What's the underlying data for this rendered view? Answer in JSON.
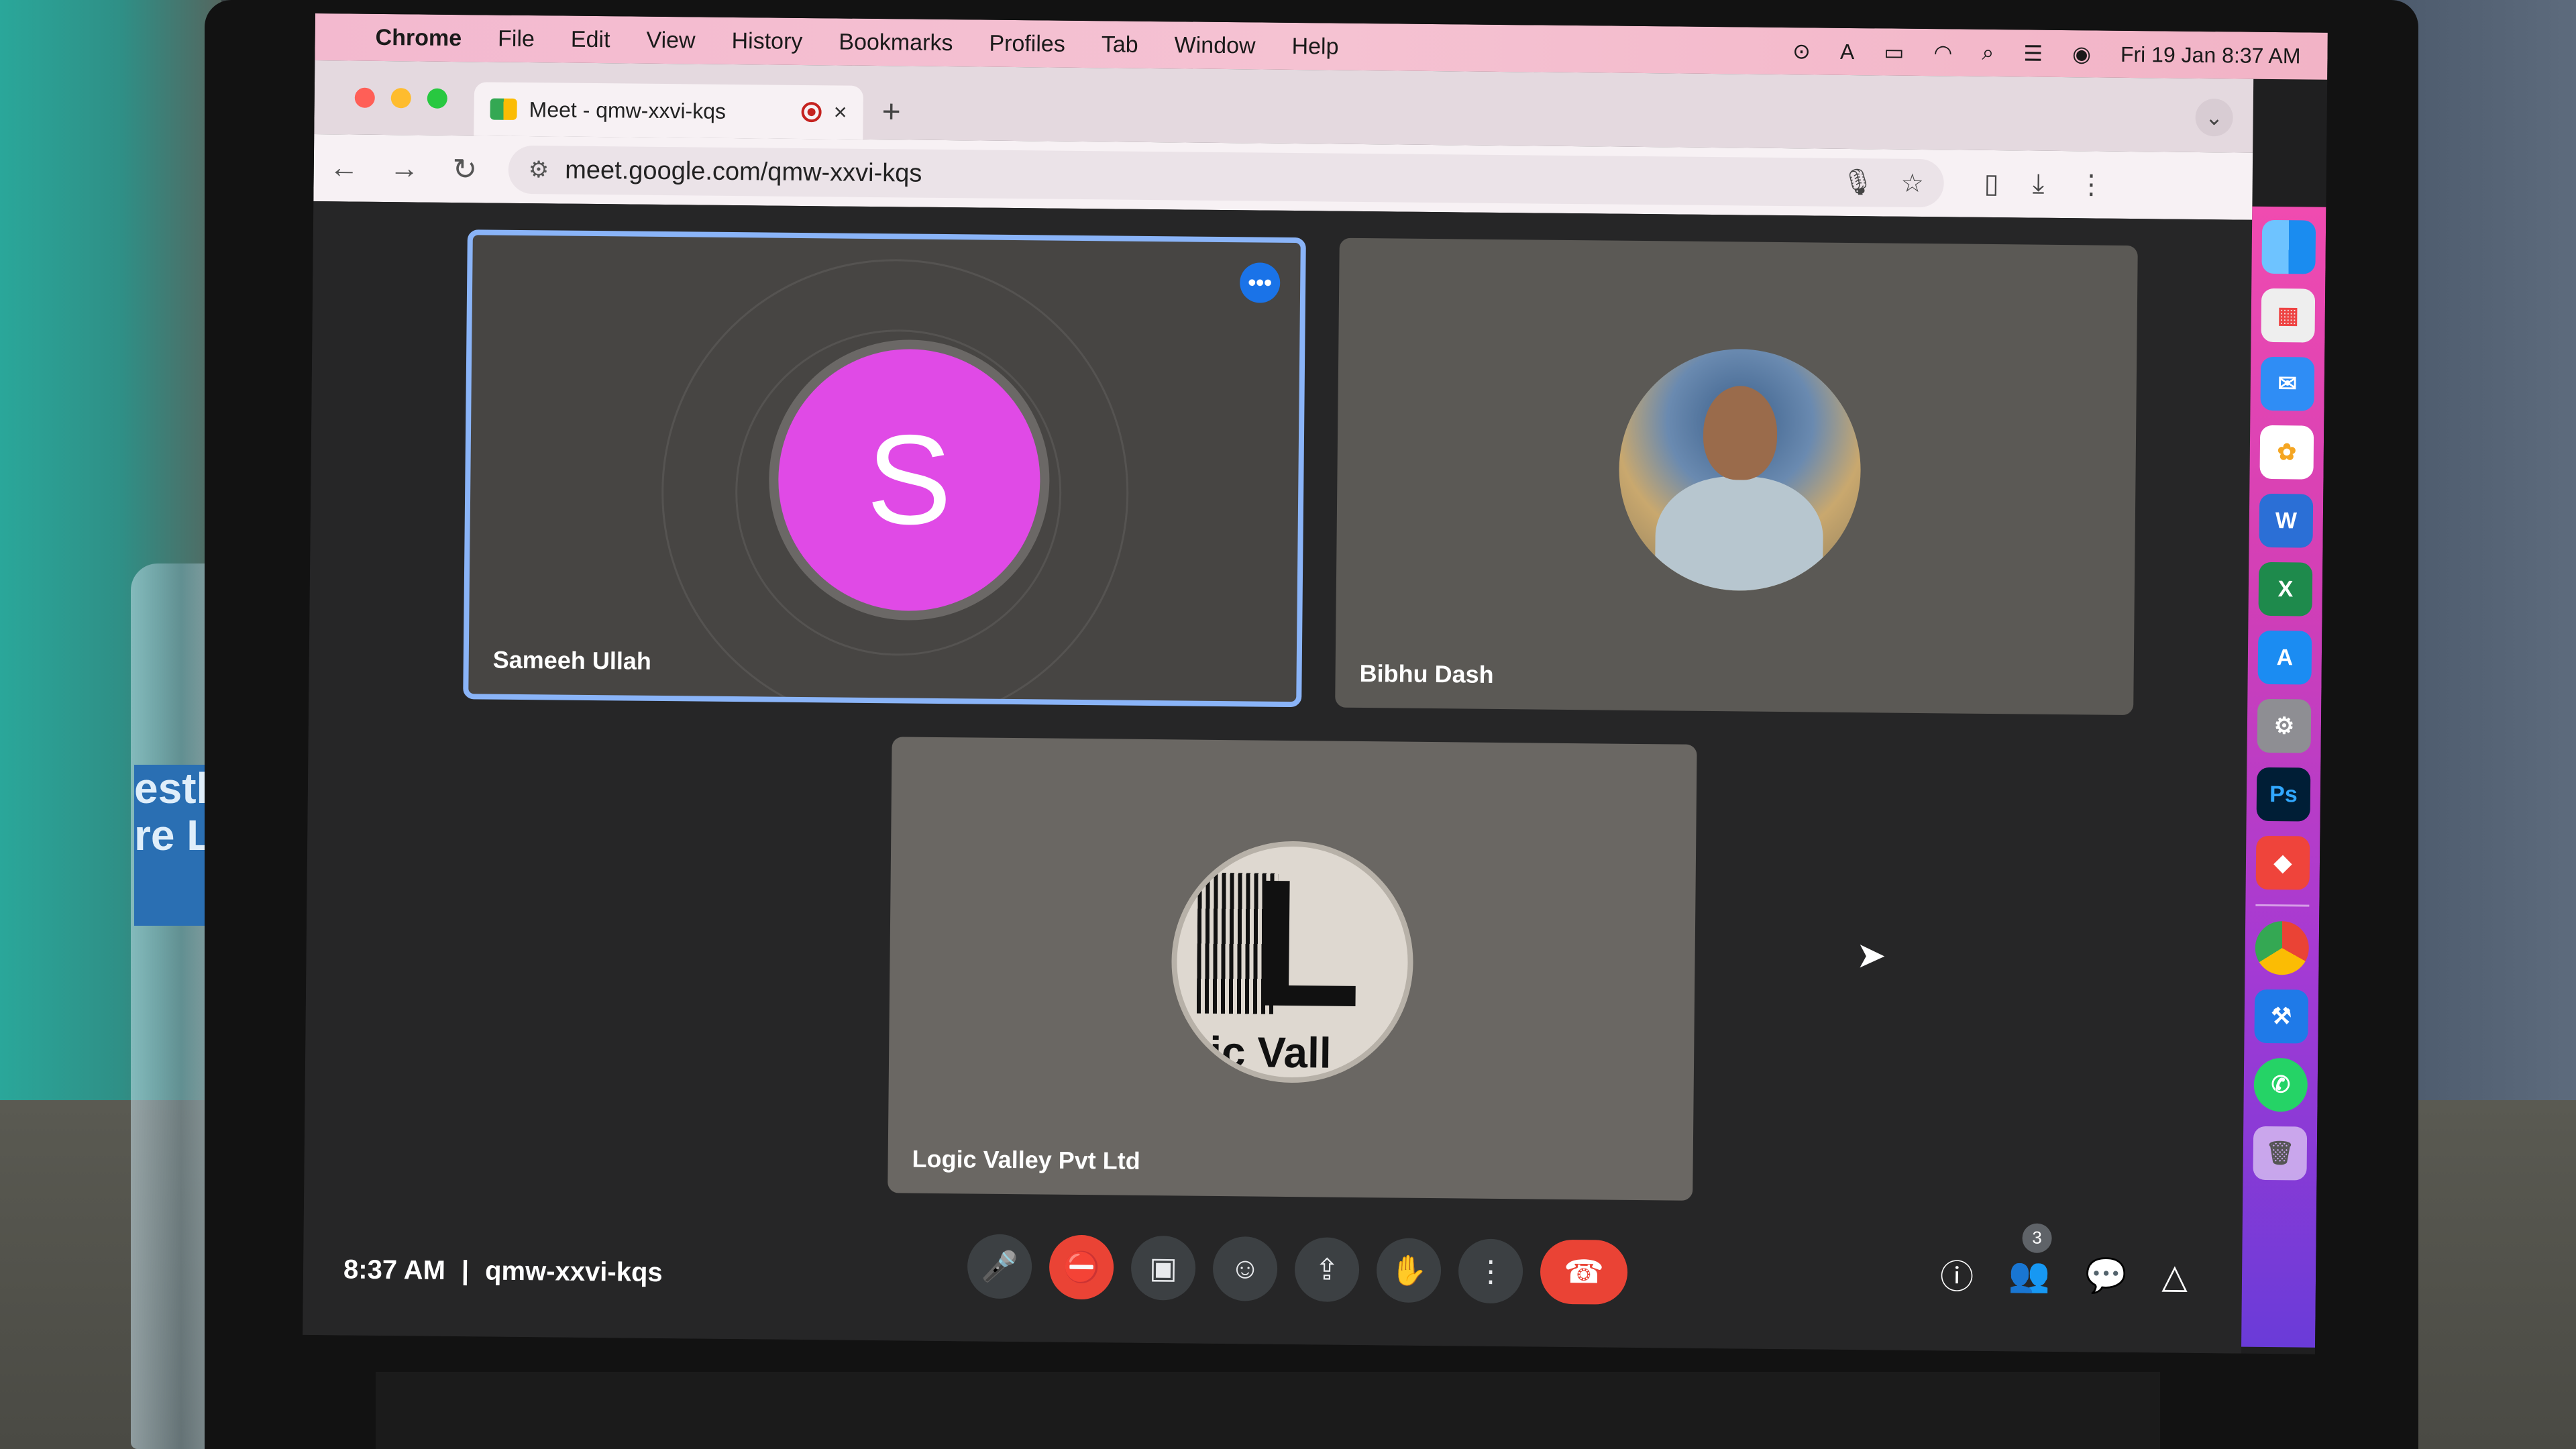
{
  "menubar": {
    "app_name": "Chrome",
    "menus": [
      "File",
      "Edit",
      "View",
      "History",
      "Bookmarks",
      "Profiles",
      "Tab",
      "Window",
      "Help"
    ],
    "datetime": "Fri 19 Jan  8:37 AM"
  },
  "tab": {
    "title": "Meet - qmw-xxvi-kqs",
    "close_glyph": "×",
    "new_tab_glyph": "+"
  },
  "address_bar": {
    "url": "meet.google.com/qmw-xxvi-kqs"
  },
  "participants": [
    {
      "name": "Sameeh Ullah",
      "initial": "S"
    },
    {
      "name": "Bibhu Dash"
    },
    {
      "name": "Logic Valley Pvt Ltd",
      "logo_text": "L",
      "logo_subtext": "ic Vall"
    }
  ],
  "meeting": {
    "time": "8:37 AM",
    "separator": "|",
    "code": "qmw-xxvi-kqs",
    "people_count": "3"
  },
  "bottle_label": "estle\nre Li",
  "dock_apps": [
    "finder-icon",
    "launchpad-icon",
    "mail-icon",
    "photos-icon",
    "word-icon",
    "excel-icon",
    "app-store-icon",
    "system-settings-icon",
    "photoshop-icon",
    "anydesk-icon",
    "chrome-icon",
    "xcode-icon",
    "whatsapp-icon",
    "trash-icon"
  ],
  "dock_labels": {
    "photoshop": "Ps",
    "word": "W",
    "excel": "X"
  },
  "colors": {
    "avatar_s": "#e04ae6",
    "active_border": "#8ab4f8",
    "end_call": "#ea4335",
    "dock_top": "#f04bb0",
    "dock_bottom": "#6a3bd8"
  }
}
